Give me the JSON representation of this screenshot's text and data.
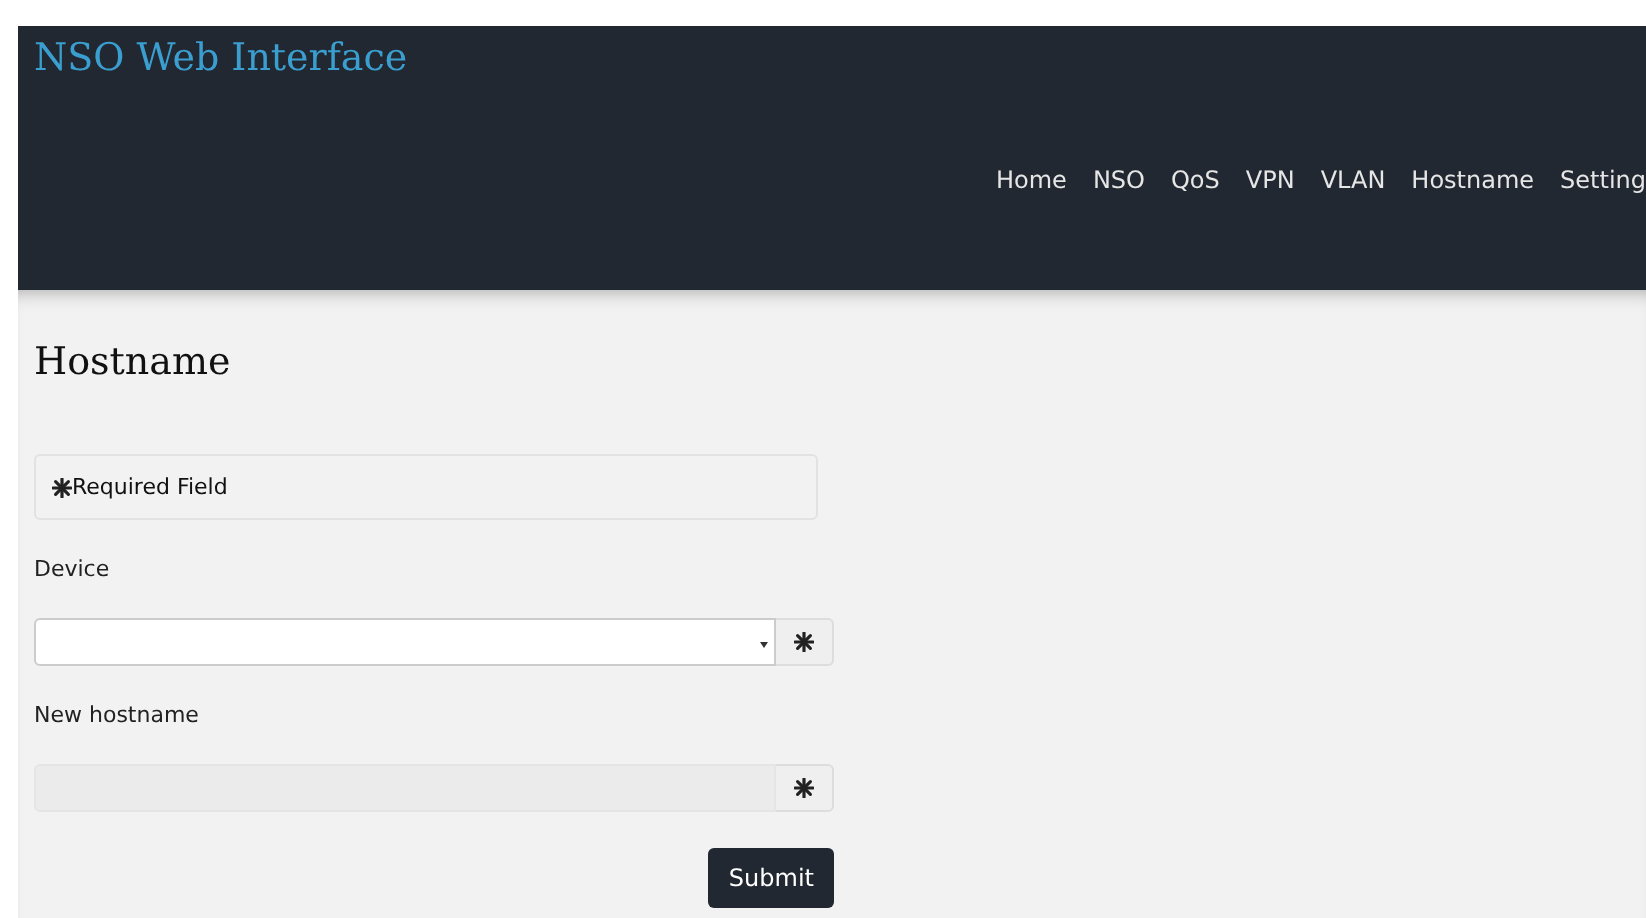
{
  "header": {
    "title": "NSO Web Interface",
    "nav": [
      {
        "label": "Home",
        "selected": false
      },
      {
        "label": "NSO",
        "selected": false
      },
      {
        "label": "QoS",
        "selected": false
      },
      {
        "label": "VPN",
        "selected": false
      },
      {
        "label": "VLAN",
        "selected": false
      },
      {
        "label": "Hostname",
        "selected": false
      },
      {
        "label": "Setting",
        "selected": false
      }
    ]
  },
  "page": {
    "heading": "Hostname",
    "required_note": "Required Field",
    "fields": [
      {
        "label": "Device",
        "kind": "select",
        "disabled": false,
        "required": true
      },
      {
        "label": "New hostname",
        "kind": "text",
        "disabled": true,
        "required": true
      }
    ],
    "submit": "Submit"
  }
}
